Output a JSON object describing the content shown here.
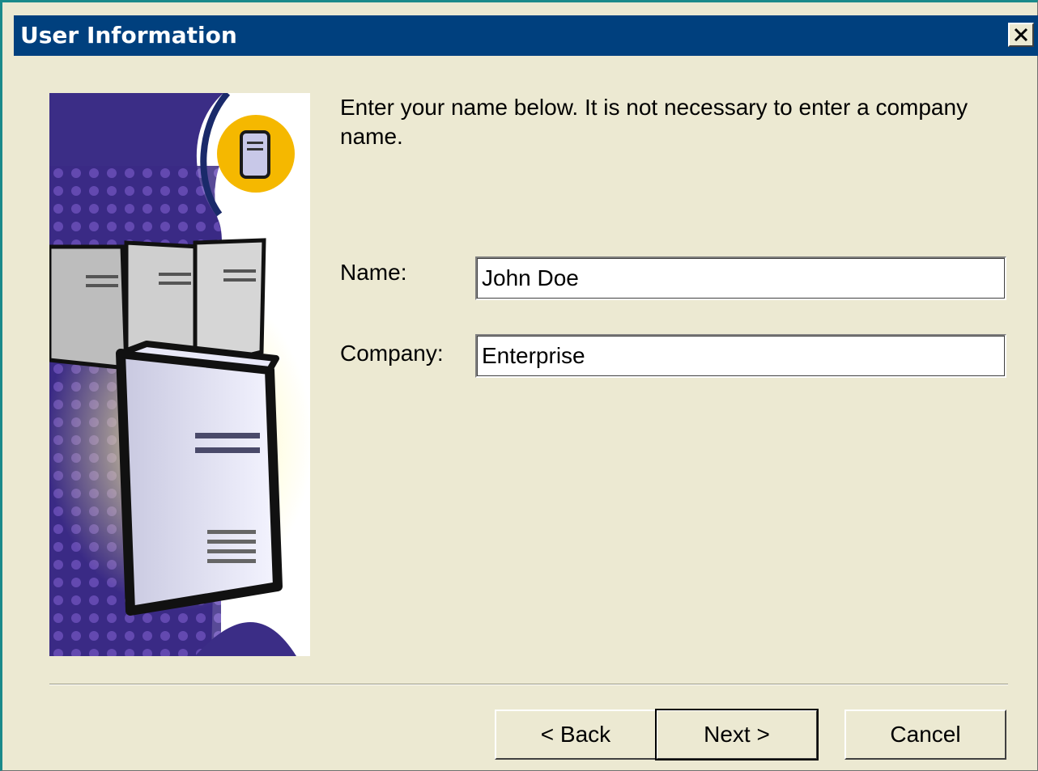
{
  "window": {
    "title": "User Information",
    "close_icon": "close-icon",
    "title_bar_color": "#00407e"
  },
  "instruction": "Enter your name below.  It is not necessary to enter a company name.",
  "form": {
    "name_label": "Name:",
    "name_value": "John Doe",
    "company_label": "Company:",
    "company_value": "Enterprise"
  },
  "buttons": {
    "back_label": "< Back",
    "next_label": "Next >",
    "cancel_label": "Cancel"
  }
}
